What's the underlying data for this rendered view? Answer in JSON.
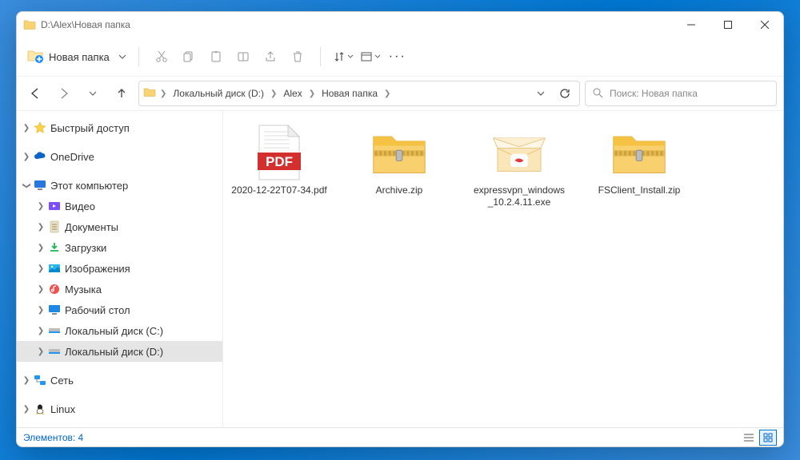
{
  "window": {
    "title": "D:\\Alex\\Новая папка"
  },
  "toolbar": {
    "new_label": "Новая папка"
  },
  "breadcrumb": {
    "segments": [
      "Локальный диск (D:)",
      "Alex",
      "Новая папка"
    ]
  },
  "search": {
    "placeholder": "Поиск: Новая папка"
  },
  "sidebar": {
    "quick_access": "Быстрый доступ",
    "onedrive": "OneDrive",
    "this_pc": "Этот компьютер",
    "subfolders": {
      "video": "Видео",
      "documents": "Документы",
      "downloads": "Загрузки",
      "pictures": "Изображения",
      "music": "Музыка",
      "desktop": "Рабочий стол",
      "disk_c": "Локальный диск (C:)",
      "disk_d": "Локальный диск (D:)"
    },
    "network": "Сеть",
    "linux": "Linux"
  },
  "files": [
    {
      "name": "2020-12-22T07-34.pdf",
      "type": "pdf"
    },
    {
      "name": "Archive.zip",
      "type": "zip"
    },
    {
      "name": "expressvpn_windows_10.2.4.11.exe",
      "type": "exe"
    },
    {
      "name": "FSClient_Install.zip",
      "type": "zip"
    }
  ],
  "status": {
    "count_label": "Элементов: 4"
  }
}
